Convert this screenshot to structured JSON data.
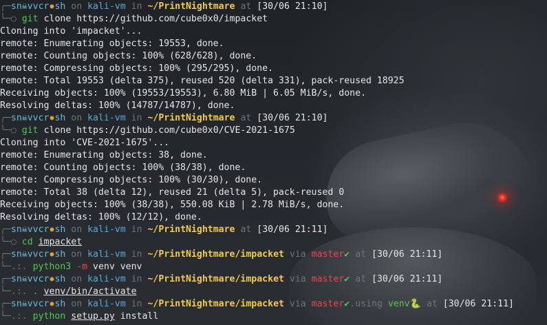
{
  "prompts": [
    {
      "user": "sn",
      "icon1": "☠",
      "mid": "vvcr",
      "icon2": "✸",
      "tail": "sh",
      "on": " on ",
      "host": "kali-vm",
      "in": " in ",
      "path": "~/PrintNightmare",
      "at": " at ",
      "time": "[30/06 21:10]"
    },
    {
      "user": "sn",
      "icon1": "☠",
      "mid": "vvcr",
      "icon2": "✸",
      "tail": "sh",
      "on": " on ",
      "host": "kali-vm",
      "in": " in ",
      "path": "~/PrintNightmare",
      "at": " at ",
      "time": "[30/06 21:10]"
    },
    {
      "user": "sn",
      "icon1": "☠",
      "mid": "vvcr",
      "icon2": "✸",
      "tail": "sh",
      "on": " on ",
      "host": "kali-vm",
      "in": " in ",
      "path": "~/PrintNightmare",
      "at": " at ",
      "time": "[30/06 21:11]"
    },
    {
      "user": "sn",
      "icon1": "☠",
      "mid": "vvcr",
      "icon2": "✸",
      "tail": "sh",
      "on": " on ",
      "host": "kali-vm",
      "in": " in ",
      "path": "~/PrintNightmare/impacket",
      "via": " via ",
      "branch": "master",
      "check": "✔",
      "at": " at ",
      "time": "[30/06 21:11]"
    },
    {
      "user": "sn",
      "icon1": "☠",
      "mid": "vvcr",
      "icon2": "✸",
      "tail": "sh",
      "on": " on ",
      "host": "kali-vm",
      "in": " in ",
      "path": "~/PrintNightmare/impacket",
      "via": " via ",
      "branch": "master",
      "check": "✔",
      "at": " at ",
      "time": "[30/06 21:11]"
    },
    {
      "user": "sn",
      "icon1": "☠",
      "mid": "vvcr",
      "icon2": "✸",
      "tail": "sh",
      "on": " on ",
      "host": "kali-vm",
      "in": " in ",
      "path": "~/PrintNightmare/impacket",
      "via": " via ",
      "branch": "master",
      "check": "✔",
      "using": ".using ",
      "venv": "venv",
      "snake": "🐍",
      "at": " at ",
      "time": "[30/06 21:11]"
    }
  ],
  "commands": [
    {
      "corner": "╰─",
      "marker": "○",
      "cmd": "git",
      "args": " clone https://github.com/cube0x0/impacket"
    },
    {
      "corner": "╰─",
      "marker": "○",
      "cmd": "git",
      "args": " clone https://github.com/cube0x0/CVE-2021-1675"
    },
    {
      "corner": "╰─",
      "marker": "○",
      "cmd": "cd",
      "args_u": "impacket"
    },
    {
      "corner": "└─",
      "marker": ".:.",
      "cmd": "python3",
      "flag": "-m",
      "args": " venv venv"
    },
    {
      "corner": "└─",
      "marker": ".:.",
      "cmd": ".",
      "args_u": "venv/bin/activate"
    },
    {
      "corner": "└─",
      "marker": ".:.",
      "cmd": "python",
      "args_u": "setup.py",
      "args": " install"
    }
  ],
  "output1": [
    "Cloning into 'impacket'...",
    "remote: Enumerating objects: 19553, done.",
    "remote: Counting objects: 100% (628/628), done.",
    "remote: Compressing objects: 100% (295/295), done.",
    "remote: Total 19553 (delta 375), reused 520 (delta 331), pack-reused 18925",
    "Receiving objects: 100% (19553/19553), 6.80 MiB | 6.05 MiB/s, done.",
    "Resolving deltas: 100% (14787/14787), done."
  ],
  "output2": [
    "Cloning into 'CVE-2021-1675'...",
    "remote: Enumerating objects: 38, done.",
    "remote: Counting objects: 100% (38/38), done.",
    "remote: Compressing objects: 100% (30/30), done.",
    "remote: Total 38 (delta 12), reused 21 (delta 5), pack-reused 0",
    "Receiving objects: 100% (38/38), 550.08 KiB | 2.78 MiB/s, done.",
    "Resolving deltas: 100% (12/12), done."
  ],
  "colors": {
    "path": "#f2c94c",
    "branch": "#e5484d",
    "command": "#57c554",
    "prompt_user": "#6cb6dc"
  }
}
